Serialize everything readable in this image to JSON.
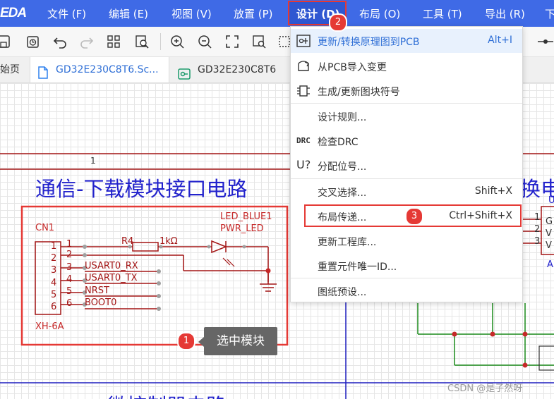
{
  "app": {
    "logo": "EDA"
  },
  "menubar": {
    "items": [
      "文件 (F)",
      "编辑 (E)",
      "视图 (V)",
      "放置 (P)",
      "设计 (D)",
      "布局 (O)",
      "工具 (T)",
      "导出 (R)",
      "下"
    ]
  },
  "toolbar": {
    "icons": [
      "save-icon",
      "save-all-icon",
      "undo-icon",
      "redo-icon",
      "grid-icon",
      "find-icon",
      "zoom-in-icon",
      "zoom-out-icon",
      "fit-icon",
      "zoom-area-icon",
      "select-icon",
      "wire-icon"
    ]
  },
  "tabs": [
    {
      "label": "始页"
    },
    {
      "label": "GD32E230C8T6.Sc..."
    },
    {
      "label": "GD32E230C8T6"
    }
  ],
  "design_menu": {
    "items": [
      {
        "label": "更新/转换原理图到PCB",
        "shortcut": "Alt+I",
        "icon": "update-pcb-icon"
      },
      {
        "label": "从PCB导入变更",
        "shortcut": "",
        "icon": "import-icon"
      },
      {
        "label": "生成/更新图块符号",
        "shortcut": "",
        "icon": "symbol-icon"
      },
      {
        "label": "设计规则...",
        "shortcut": "",
        "icon": ""
      },
      {
        "label": "检查DRC",
        "shortcut": "",
        "icon": "drc-icon"
      },
      {
        "label": "分配位号...",
        "shortcut": "",
        "icon": "designator-icon"
      },
      {
        "label": "交叉选择...",
        "shortcut": "Shift+X",
        "icon": ""
      },
      {
        "label": "布局传递...",
        "shortcut": "Ctrl+Shift+X",
        "icon": ""
      },
      {
        "label": "更新工程库...",
        "shortcut": "",
        "icon": ""
      },
      {
        "label": "重置元件唯一ID...",
        "shortcut": "",
        "icon": ""
      },
      {
        "label": "图纸预设...",
        "shortcut": "",
        "icon": ""
      }
    ],
    "drc_prefix": "DRC",
    "designator_prefix": "U?"
  },
  "schematic": {
    "frame_number": "1",
    "block_title": "通信-下载模块接口电路",
    "right_title_fragment": "换电",
    "connector_ref": "CN1",
    "connector_name": "XH-6A",
    "pins": [
      "1",
      "2",
      "3",
      "4",
      "5",
      "6"
    ],
    "net_labels": [
      "USART0_RX",
      "USART0_TX",
      "NRST",
      "BOOT0"
    ],
    "resistor_ref": "R4",
    "resistor_value": "1kΩ",
    "led_ref": "LED_BLUE1",
    "led_net": "PWR_LED",
    "chip_prefix": "U",
    "chip_pins": [
      "1",
      "2",
      "3"
    ],
    "chip_pin_names": [
      "G",
      "V",
      "V"
    ],
    "chip_suffix": "A",
    "bottom_title_fragment": "微控制器电路"
  },
  "annotations": {
    "badge1": "1",
    "badge2": "2",
    "badge3": "3",
    "tooltip": "选中模块"
  },
  "watermark": "CSDN @是子然呀",
  "colors": {
    "menubar": "#3f6ae6",
    "accent_red": "#e53935",
    "schematic_wire": "#c62828",
    "title_blue": "#2222cc",
    "green_wire": "#1a8a1a"
  }
}
